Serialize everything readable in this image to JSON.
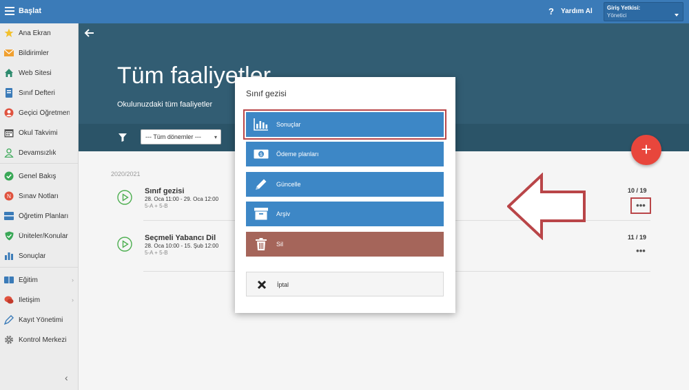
{
  "topbar": {
    "app_title": "Başlat",
    "help_label": "Yardım Al",
    "role_title": "Giriş Yetkisi:",
    "role_value": "Yönetici"
  },
  "sidebar": {
    "items": [
      {
        "label": "Ana Ekran",
        "icon": "star-icon"
      },
      {
        "label": "Bildirimler",
        "icon": "envelope-icon"
      },
      {
        "label": "Web Sitesi",
        "icon": "home-icon"
      },
      {
        "label": "Sınıf Defteri",
        "icon": "notebook-icon"
      },
      {
        "label": "Geçici Öğretmen",
        "icon": "person-icon"
      },
      {
        "label": "Okul Takvimi",
        "icon": "calendar-icon"
      },
      {
        "label": "Devamsızlık",
        "icon": "person-outline-icon"
      },
      {
        "label": "Genel Bakış",
        "icon": "check-circle-icon"
      },
      {
        "label": "Sınav Notları",
        "icon": "grade-icon"
      },
      {
        "label": "Öğretim Planları",
        "icon": "plan-icon"
      },
      {
        "label": "Üniteler/Konular",
        "icon": "shield-icon"
      },
      {
        "label": "Sonuçlar",
        "icon": "bar-chart-icon"
      },
      {
        "label": "Eğitim",
        "icon": "book-icon"
      },
      {
        "label": "İletişim",
        "icon": "chat-icon"
      },
      {
        "label": "Kayıt Yönetimi",
        "icon": "pen-icon"
      },
      {
        "label": "Kontrol Merkezi",
        "icon": "gear-icon"
      }
    ]
  },
  "header": {
    "title": "Tüm faaliyetler",
    "subtitle": "Okulunuzdaki tüm faaliyetler",
    "term_select": "--- Tüm dönemler ---"
  },
  "content": {
    "year": "2020/2021",
    "activities": [
      {
        "title": "Sınıf gezisi",
        "dates": "28. Oca 11:00 - 29. Oca 12:00",
        "classes": "5-A + 5-B",
        "count": "10 / 19"
      },
      {
        "title": "Seçmeli Yabancı Dil",
        "dates": "28. Oca 10:00 - 15. Şub 12:00",
        "classes": "5-A + 5-B",
        "count": "11 / 19"
      }
    ]
  },
  "modal": {
    "title": "Sınıf gezisi",
    "buttons": [
      {
        "label": "Sonuçlar",
        "icon": "bar-chart-icon"
      },
      {
        "label": "Ödeme planları",
        "icon": "money-icon"
      },
      {
        "label": "Güncelle",
        "icon": "pencil-icon"
      },
      {
        "label": "Arşiv",
        "icon": "archive-icon"
      },
      {
        "label": "Sil",
        "icon": "trash-icon"
      },
      {
        "label": "İptal",
        "icon": "x-icon"
      }
    ]
  },
  "colors": {
    "topbar": "#3b7bb8",
    "hero": "#325d73",
    "modal_button": "#3d87c6",
    "delete_button": "#a5655a",
    "fab": "#e8463c",
    "annotation": "#b94548"
  }
}
